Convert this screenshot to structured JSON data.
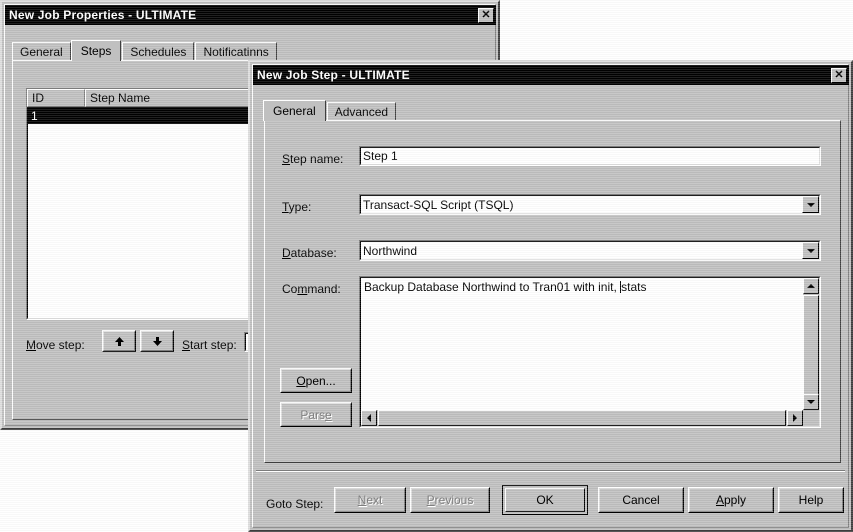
{
  "parent_window": {
    "title": "New Job Properties - ULTIMATE",
    "close_icon": "✕",
    "tabs": [
      {
        "label": "General",
        "active": false
      },
      {
        "label": "Steps",
        "active": true
      },
      {
        "label": "Schedules",
        "active": false
      },
      {
        "label": "Notificatinns",
        "active": false
      }
    ],
    "steps_list": {
      "columns": [
        "ID",
        "Step Name"
      ],
      "rows": [
        {
          "id": "1",
          "step_name": ""
        }
      ]
    },
    "move_step_label": "Move step:",
    "move_up_icon": "▲",
    "move_down_icon": "▼",
    "start_step_label": "Start step:",
    "start_step_value": ""
  },
  "child_window": {
    "title": "New Job Step - ULTIMATE",
    "close_icon": "✕",
    "tabs": [
      {
        "label": "General",
        "active": true
      },
      {
        "label": "Advanced",
        "active": false
      }
    ],
    "fields": {
      "step_name_label": "Step name:",
      "step_name_value": "Step 1",
      "type_label": "Type:",
      "type_value": "Transact-SQL Script (TSQL)",
      "database_label": "Database:",
      "database_value": "Northwind",
      "command_label": "Command:",
      "command_value_before_caret": "Backup Database Northwind to Tran01 with init, ",
      "command_value_after_caret": "stats"
    },
    "side_buttons": [
      {
        "label": "Open...",
        "disabled": false,
        "name": "open-button"
      },
      {
        "label": "Parse",
        "disabled": true,
        "name": "parse-button"
      }
    ],
    "goto_step_label": "Goto Step:",
    "footer_buttons": [
      {
        "label": "Next",
        "disabled": true,
        "default": false,
        "name": "next-button"
      },
      {
        "label": "Previous",
        "disabled": true,
        "default": false,
        "name": "previous-button"
      },
      {
        "label": "OK",
        "disabled": false,
        "default": true,
        "name": "ok-button"
      },
      {
        "label": "Cancel",
        "disabled": false,
        "default": false,
        "name": "cancel-button"
      },
      {
        "label": "Apply",
        "disabled": false,
        "default": false,
        "name": "apply-button"
      },
      {
        "label": "Help",
        "disabled": false,
        "default": false,
        "name": "help-button"
      }
    ],
    "scroll_icons": {
      "up": "▲",
      "down": "▼",
      "left": "◄",
      "right": "►"
    }
  },
  "colors": {
    "face": "#c0c0c0",
    "shadow": "#808080",
    "dark": "#000000",
    "light": "#ffffff",
    "titlebar_active": "#000000",
    "titlebar_text": "#ffffff",
    "selection": "#000000"
  }
}
